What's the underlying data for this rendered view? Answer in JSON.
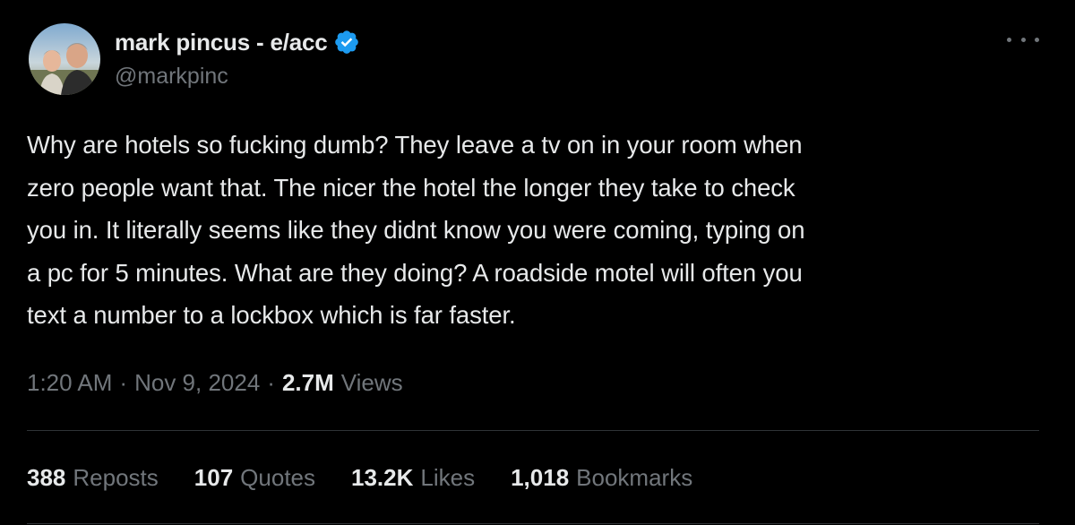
{
  "author": {
    "display_name": "mark pincus - e/acc",
    "handle": "@markpinc",
    "verified_icon": "verified-badge-icon",
    "verified_color": "#1d9bf0"
  },
  "tweet": {
    "text": "Why are hotels so fucking dumb? They leave a tv on in your room when\nzero people want that. The nicer the hotel the longer they take to check\nyou in. It literally seems like they didnt know you were coming, typing on\na pc for 5 minutes. What are they doing? A roadside motel will often you\ntext a number to a lockbox which is far faster."
  },
  "meta": {
    "time": "1:20 AM",
    "separator": "·",
    "date": "Nov 9, 2024",
    "views_count": "2.7M",
    "views_label": "Views"
  },
  "stats": {
    "reposts_count": "388",
    "reposts_label": "Reposts",
    "quotes_count": "107",
    "quotes_label": "Quotes",
    "likes_count": "13.2K",
    "likes_label": "Likes",
    "bookmarks_count": "1,018",
    "bookmarks_label": "Bookmarks"
  },
  "icons": {
    "more": "more-options-icon",
    "avatar": "avatar"
  },
  "colors": {
    "background": "#000000",
    "text_primary": "#e7e9ea",
    "text_secondary": "#71767b",
    "divider": "#2f3336"
  }
}
